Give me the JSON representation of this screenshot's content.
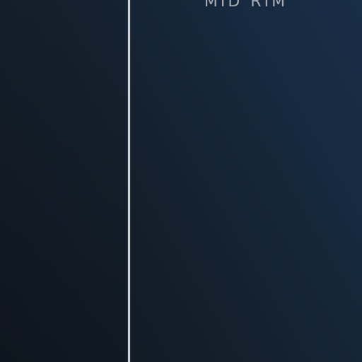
{
  "panel": {
    "title": "MID RIM"
  },
  "colors": {
    "background_dark": "#0f161f",
    "background_accent": "#182d48",
    "divider": "#cfd3d6",
    "title_text": "#a7adb3"
  }
}
